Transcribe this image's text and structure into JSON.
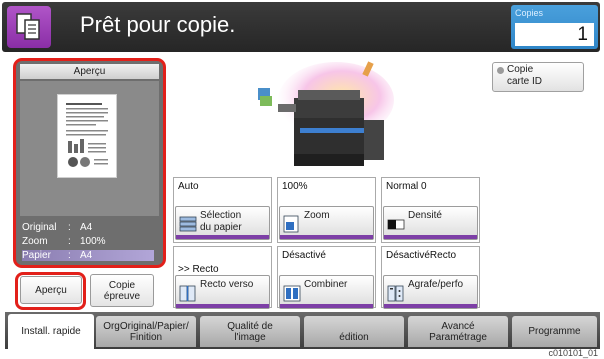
{
  "header": {
    "title": "Prêt pour copie.",
    "copies_label": "Copies",
    "copies_value": "1",
    "app_icon": "copy-icon"
  },
  "preview": {
    "title": "Aperçu",
    "info": [
      {
        "key": "Original",
        "value": "A4"
      },
      {
        "key": "Zoom",
        "value": "100%"
      },
      {
        "key": "Papier",
        "value": "A4"
      }
    ],
    "separator": ":"
  },
  "buttons": {
    "preview": "Aperçu",
    "proof_copy": [
      "Copie",
      "épreuve"
    ],
    "id_card_copy": [
      "Copie",
      "carte ID"
    ]
  },
  "tiles": {
    "paper": {
      "value": "Auto",
      "label": [
        "Sélection",
        "du papier"
      ],
      "icon": "paper-tray-icon"
    },
    "zoom": {
      "value": "100%",
      "label": [
        "Zoom"
      ],
      "icon": "zoom-icon"
    },
    "density": {
      "value": "Normal 0",
      "label": [
        "Densité"
      ],
      "icon": "density-icon"
    },
    "duplex": {
      "value": ">> Recto",
      "label": [
        "Recto verso"
      ],
      "icon": "duplex-icon"
    },
    "combine": {
      "value": "Désactivé",
      "label": [
        "Combiner"
      ],
      "icon": "combine-icon"
    },
    "staple": {
      "value": "DésactivéRecto",
      "label": [
        "Agrafe/perfo"
      ],
      "icon": "staple-punch-icon"
    }
  },
  "tabs": [
    {
      "label": [
        "Install. rapide"
      ],
      "active": true
    },
    {
      "label": [
        "OrgOriginal/Papier/",
        "Finition"
      ],
      "active": false
    },
    {
      "label": [
        "Qualité de",
        "l'image"
      ],
      "active": false
    },
    {
      "label": [
        "",
        "édition"
      ],
      "active": false
    },
    {
      "label": [
        "Avancé",
        "Paramétrage"
      ],
      "active": false
    },
    {
      "label": [
        "Programme"
      ],
      "active": false
    }
  ],
  "colors": {
    "accent_purple": "#7d3fa6",
    "highlight_red": "#e2201a",
    "copies_blue": "#2f86c8"
  },
  "footer_code": "c010101_01"
}
